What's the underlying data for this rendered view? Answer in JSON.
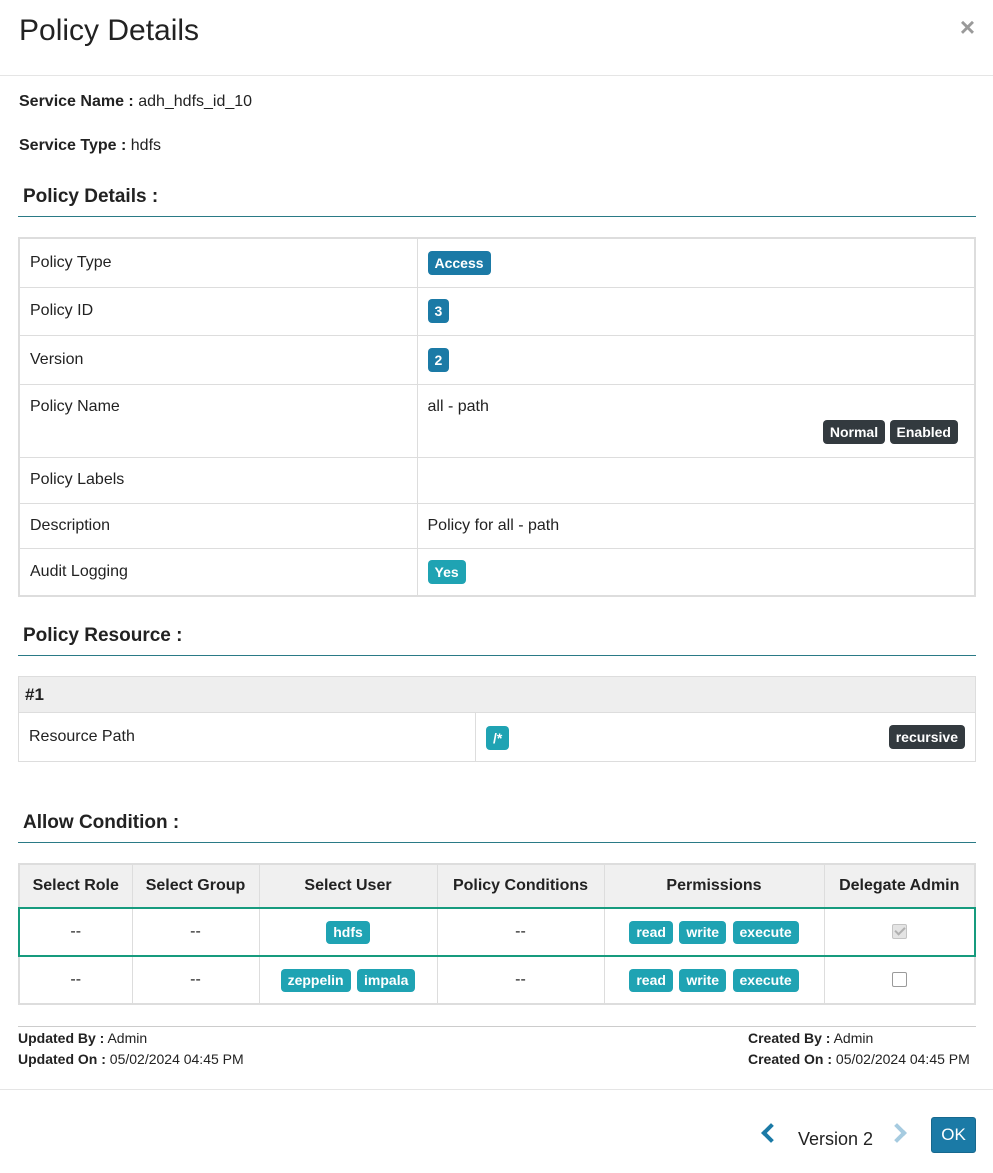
{
  "modal": {
    "title": "Policy Details",
    "close": "×"
  },
  "service": {
    "name_label": "Service Name :",
    "name_value": "adh_hdfs_id_10",
    "type_label": "Service Type :",
    "type_value": "hdfs"
  },
  "sections": {
    "policy_details": "Policy Details :",
    "policy_resource": "Policy Resource :",
    "allow_condition": "Allow Condition :"
  },
  "details": {
    "policy_type": {
      "label": "Policy Type",
      "value": "Access"
    },
    "policy_id": {
      "label": "Policy ID",
      "value": "3"
    },
    "version": {
      "label": "Version",
      "value": "2"
    },
    "policy_name": {
      "label": "Policy Name",
      "value": "all - path",
      "badge_normal": "Normal",
      "badge_enabled": "Enabled"
    },
    "policy_labels": {
      "label": "Policy Labels",
      "value": ""
    },
    "description": {
      "label": "Description",
      "value": "Policy for all - path"
    },
    "audit_logging": {
      "label": "Audit Logging",
      "value": "Yes"
    }
  },
  "resource": {
    "header": "#1",
    "label": "Resource Path",
    "path": "/*",
    "recursive": "recursive"
  },
  "allow": {
    "headers": [
      "Select Role",
      "Select Group",
      "Select User",
      "Policy Conditions",
      "Permissions",
      "Delegate Admin"
    ],
    "rows": [
      {
        "role": "--",
        "group": "--",
        "users": [
          "hdfs"
        ],
        "conditions": "--",
        "permissions": [
          "read",
          "write",
          "execute"
        ],
        "delegate_admin": true
      },
      {
        "role": "--",
        "group": "--",
        "users": [
          "zeppelin",
          "impala"
        ],
        "conditions": "--",
        "permissions": [
          "read",
          "write",
          "execute"
        ],
        "delegate_admin": false
      }
    ]
  },
  "audit": {
    "updated_by_label": "Updated By :",
    "updated_by": "Admin",
    "updated_on_label": "Updated On :",
    "updated_on": "05/02/2024 04:45 PM",
    "created_by_label": "Created By :",
    "created_by": "Admin",
    "created_on_label": "Created On :",
    "created_on": "05/02/2024 04:45 PM"
  },
  "footer": {
    "version_label": "Version 2",
    "ok_label": "OK"
  },
  "colors": {
    "accent": "#1b7aa6",
    "tag_teal": "#1fa3b3",
    "tag_dark": "#333a3f",
    "highlight": "#179b7e"
  }
}
